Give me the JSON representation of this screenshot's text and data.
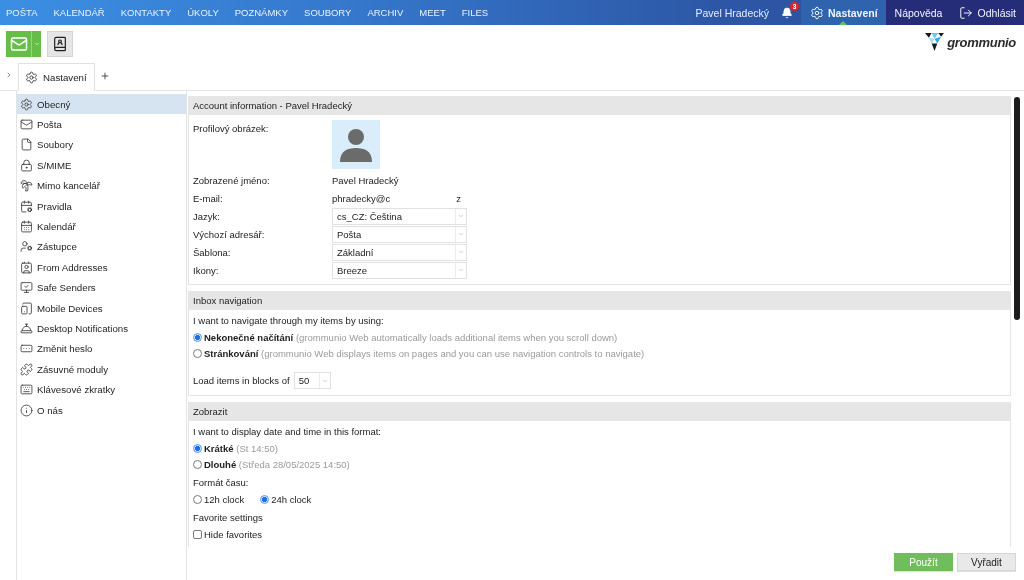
{
  "top_nav": {
    "items": [
      {
        "label": "POŠTA",
        "selected": false
      },
      {
        "label": "KALENDÁŘ",
        "selected": false
      },
      {
        "label": "KONTAKTY",
        "selected": false
      },
      {
        "label": "ÚKOLY",
        "selected": false
      },
      {
        "label": "POZNÁMKY",
        "selected": false
      },
      {
        "label": "SOUBORY",
        "selected": false
      },
      {
        "label": "ARCHIV",
        "selected": false
      },
      {
        "label": "MEET",
        "selected": false
      },
      {
        "label": "FILES",
        "selected": false
      }
    ],
    "user_name": "Pavel Hradecký",
    "notification_count": "3",
    "actions": [
      {
        "label": "Nastavení",
        "selected": true
      },
      {
        "label": "Nápověda",
        "selected": false
      },
      {
        "label": "Odhlásit",
        "selected": false
      }
    ]
  },
  "logo": {
    "text": "grommunio"
  },
  "tabs": [
    {
      "label": "Nastavení",
      "selected": true
    }
  ],
  "sidebar": {
    "items": [
      {
        "label": "Obecný",
        "selected": true
      },
      {
        "label": "Pošta",
        "selected": false
      },
      {
        "label": "Soubory",
        "selected": false
      },
      {
        "label": "S/MIME",
        "selected": false
      },
      {
        "label": "Mimo kancelář",
        "selected": false
      },
      {
        "label": "Pravidla",
        "selected": false
      },
      {
        "label": "Kalendář",
        "selected": false
      },
      {
        "label": "Zástupce",
        "selected": false
      },
      {
        "label": "From Addresses",
        "selected": false
      },
      {
        "label": "Safe Senders",
        "selected": false
      },
      {
        "label": "Mobile Devices",
        "selected": false
      },
      {
        "label": "Desktop Notifications",
        "selected": false
      },
      {
        "label": "Změnit heslo",
        "selected": false
      },
      {
        "label": "Zásuvné moduly",
        "selected": false
      },
      {
        "label": "Klávesové zkratky",
        "selected": false
      },
      {
        "label": "O nás",
        "selected": false
      }
    ]
  },
  "sections": [
    {
      "title": "Account information - Pavel Hradecký",
      "items": [
        {
          "kind": "picture",
          "label": "Profilový obrázek:"
        },
        {
          "kind": "text_value",
          "label": "Zobrazené jméno:",
          "value": "Pavel Hradecký"
        },
        {
          "kind": "email",
          "label": "E-mail:",
          "value_parts": [
            "phradecky@c",
            "z"
          ]
        },
        {
          "kind": "select",
          "label": "Jazyk:",
          "value": "cs_CZ: Čeština"
        },
        {
          "kind": "select",
          "label": "Výchozí adresář:",
          "value": "Pošta"
        },
        {
          "kind": "select",
          "label": "Šablona:",
          "value": "Základní"
        },
        {
          "kind": "select",
          "label": "Ikony:",
          "value": "Breeze"
        }
      ]
    },
    {
      "title": "Inbox navigation",
      "items": [
        {
          "kind": "note",
          "text": "I want to navigate through my items by using:"
        },
        {
          "kind": "radio",
          "label": "Nekonečné načítání",
          "description": "(grommunio Web automatically loads additional items when you scroll down)",
          "selected": true
        },
        {
          "kind": "radio",
          "label": "Stránkování",
          "description": "(grommunio Web displays items on pages and you can use navigation controls to navigate)",
          "selected": false
        },
        {
          "kind": "inline_select",
          "label": "Load items in blocks of",
          "value": "50"
        }
      ]
    },
    {
      "title": "Zobrazit",
      "items": [
        {
          "kind": "note",
          "text": "I want to display date and time in this format:"
        },
        {
          "kind": "radio",
          "label": "Krátké",
          "description": "(St 14:50)",
          "selected": true
        },
        {
          "kind": "radio",
          "label": "Dlouhé",
          "description": "(Středa 28/05/2025 14:50)",
          "selected": false
        },
        {
          "kind": "note",
          "text": "Formát času:"
        },
        {
          "kind": "radio_group",
          "options": [
            {
              "label": "12h clock",
              "selected": false
            },
            {
              "label": "24h clock",
              "selected": true
            }
          ]
        },
        {
          "kind": "note",
          "text": "Favorite settings"
        },
        {
          "kind": "checkbox",
          "label": "Hide favorites",
          "checked": false
        }
      ]
    }
  ],
  "buttons": [
    {
      "label": "Použít",
      "kind": "primary"
    },
    {
      "label": "Vyřadit",
      "kind": "secondary"
    }
  ]
}
